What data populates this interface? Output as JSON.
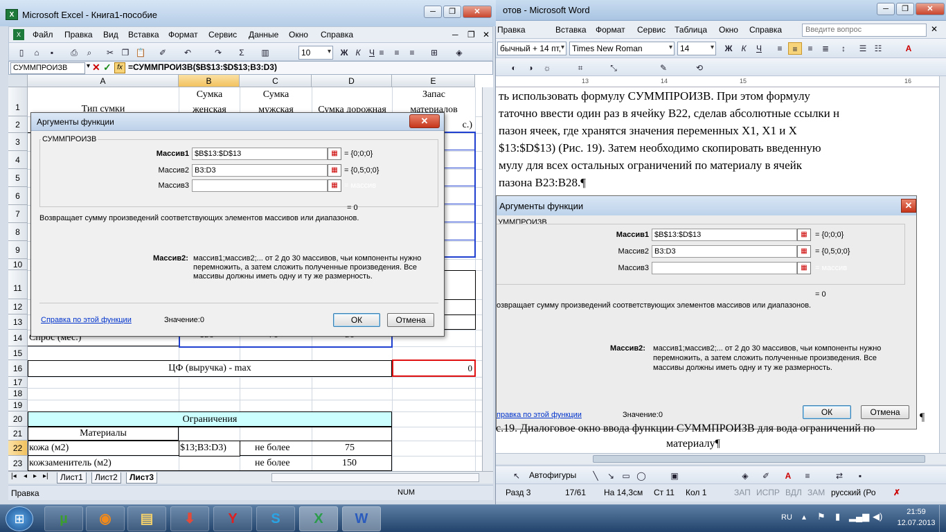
{
  "word": {
    "title": "отов - Microsoft Word",
    "menu": [
      "Правка",
      "Вставка",
      "Формат",
      "Сервис",
      "Таблица",
      "Окно",
      "Справка"
    ],
    "ask_placeholder": "Введите вопрос",
    "style_combo": "бычный + 14 пт,",
    "font_combo": "Times New Roman",
    "size_combo": "14",
    "ruler_numbers": [
      "13",
      "14",
      "15",
      "16"
    ],
    "paragraph": [
      "ть использовать формулу СУММПРОИЗВ. При этом формулу",
      "таточно ввести один раз в ячейку В22, сделав абсолютные ссылки н",
      "пазон ячеек, где хранятся значения переменных Х1, Х1 и Х",
      "$13:$D$13) (Рис. 19). Затем необходимо скопировать введенную",
      "мулу для всех остальных ограничений по материалу в ячейк",
      "пазона В23:В28.¶"
    ],
    "caption_1": "с.19. Диалоговое окно ввода функции СУММПРОИЗВ для вода ограничений по",
    "caption_2": "материалу¶",
    "pilcrow": "¶",
    "draw_label": "Автофигуры",
    "status": {
      "section": "Разд 3",
      "pages": "17/61",
      "position": "На 14,3см",
      "line": "Ст 11",
      "col": "Кол 1",
      "rec": "ЗАП",
      "trk": "ИСПР",
      "ext": "ВДЛ",
      "ovr": "ЗАМ",
      "lang": "русский (Ро"
    },
    "embedded_dialog": {
      "title": "Аргументы функции",
      "group": "УММПРОИЗВ",
      "arg1_label": "Массив1",
      "arg1_value": "$B$13:$D$13",
      "arg1_result": "= {0;0;0}",
      "arg2_label": "Массив2",
      "arg2_value": "B3:D3",
      "arg2_result": "= {0,5;0;0}",
      "arg3_label": "Массив3",
      "arg3_result": "= массив",
      "total": "= 0",
      "desc": "озвращает сумму произведений соответствующих элементов массивов или диапазонов.",
      "help_label": "Массив2:",
      "help_1": "массив1;массив2;... от 2 до 30 массивов, чьи компоненты нужно",
      "help_2": "перемножить, а затем сложить полученные произведения. Все",
      "help_3": "массивы должны иметь одну и ту же размерность.",
      "link": "правка по этой функции",
      "value": "Значение:0",
      "ok": "ОК",
      "cancel": "Отмена"
    }
  },
  "excel": {
    "title": "Microsoft Excel - Книга1-пособие",
    "menu": [
      "Файл",
      "Правка",
      "Вид",
      "Вставка",
      "Формат",
      "Сервис",
      "Данные",
      "Окно",
      "Справка"
    ],
    "font_size": "10",
    "name_box": "СУММПРОИЗВ",
    "formula": "=СУММПРОИЗВ($B$13:$D$13;B3:D3)",
    "columns": [
      "A",
      "B",
      "C",
      "D",
      "E"
    ],
    "rows": [
      "1",
      "2",
      "3",
      "4",
      "5",
      "6",
      "7",
      "8",
      "9",
      "10",
      "11",
      "12",
      "13",
      "14",
      "15",
      "16",
      "17",
      "18",
      "19",
      "20",
      "21",
      "22",
      "23"
    ],
    "header_a": "Тип сумки",
    "header_b": [
      "Сумка",
      "женская"
    ],
    "header_c": [
      "Сумка",
      "мужская"
    ],
    "header_d": "Сумка дорожная",
    "header_e": [
      "Запас",
      "материалов",
      "с.)"
    ],
    "row14_a": "Спрос (мес.)",
    "row14_b": "150",
    "row14_c": "70",
    "row14_d": "50",
    "row16_label": "ЦФ (выручка) - max",
    "row16_e": "0",
    "row20_label": "Ограничения",
    "row21_a": "Материалы",
    "row22_a": "кожа (м2)",
    "row22_b": "$13;B3:D3)",
    "row22_c": "не более",
    "row22_d": "75",
    "row23_a": "кожзаменитель (м2)",
    "row23_c": "не более",
    "row23_d": "150",
    "sheets": [
      "Лист1",
      "Лист2",
      "Лист3"
    ],
    "status_left": "Правка",
    "status_num": "NUM"
  },
  "dialog": {
    "title": "Аргументы функции",
    "group": "СУММПРОИЗВ",
    "arg1_label": "Массив1",
    "arg1_value": "$B$13:$D$13",
    "arg1_result": "= {0;0;0}",
    "arg2_label": "Массив2",
    "arg2_value": "B3:D3",
    "arg2_result": "= {0,5;0;0}",
    "arg3_label": "Массив3",
    "arg3_value": "",
    "arg3_result": "= массив",
    "total": "= 0",
    "desc": "Возвращает сумму произведений соответствующих элементов массивов или диапазонов.",
    "help_label": "Массив2:",
    "help_1": "массив1;массив2;... от 2 до 30 массивов, чьи компоненты нужно",
    "help_2": "перемножить, а затем сложить полученные произведения. Все",
    "help_3": "массивы должны иметь одну и ту же размерность.",
    "link": "Справка по этой функции",
    "value": "Значение:0",
    "ok": "ОК",
    "cancel": "Отмена"
  },
  "taskbar": {
    "lang": "RU",
    "time": "21:59",
    "date": "12.07.2013"
  },
  "colors": {
    "accent_blue": "#1f3fd0",
    "accent_red": "#e01010",
    "header_fill": "#ccffff"
  }
}
